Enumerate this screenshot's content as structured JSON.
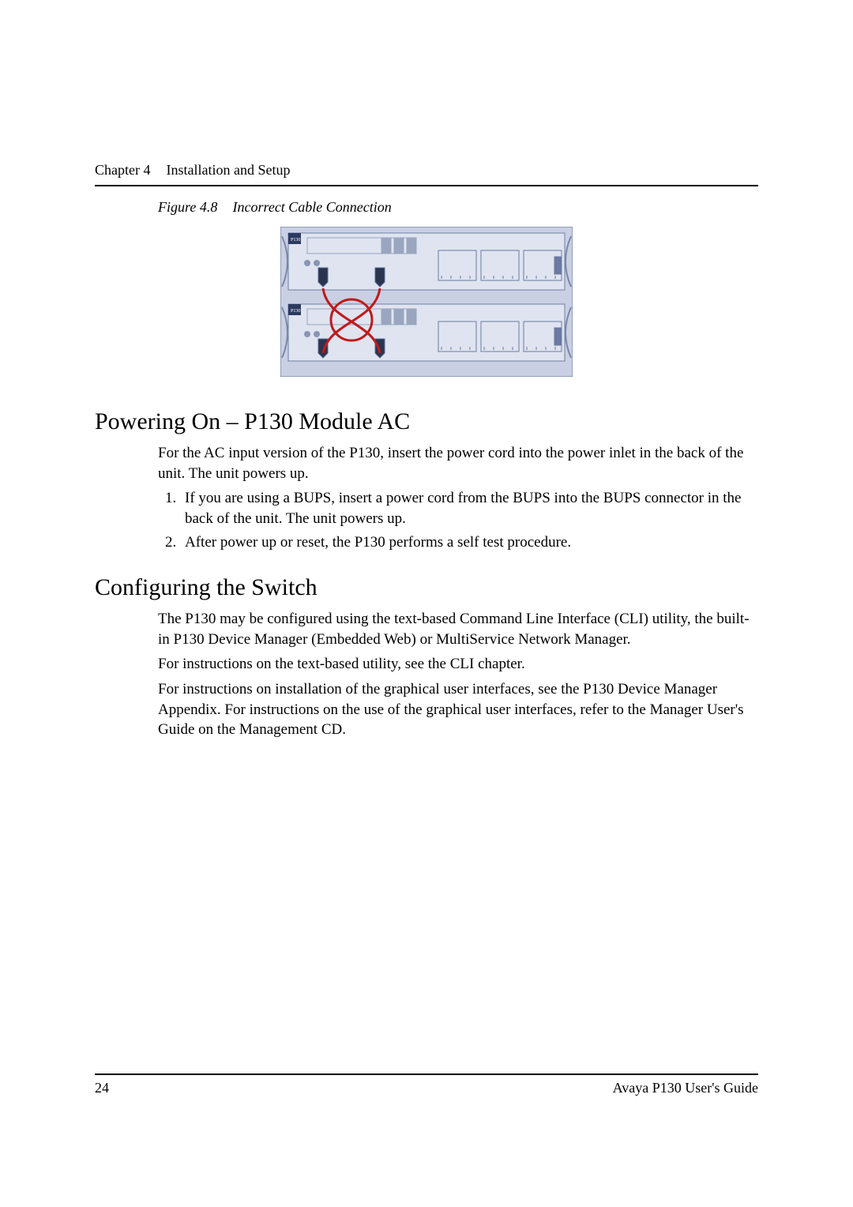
{
  "chapter": {
    "label": "Chapter 4",
    "title": "Installation and Setup"
  },
  "figure": {
    "number": "Figure 4.8",
    "caption": "Incorrect Cable Connection"
  },
  "h1": "Powering On – P130 Module AC",
  "p1": "For the AC input version of the P130, insert the power cord into the power inlet in the back of the unit. The unit powers up.",
  "li1": "If you are using a BUPS, insert a power cord from the BUPS into the BUPS connector in the back of the unit. The unit powers up.",
  "li2": "After power up or reset, the P130 performs a self test procedure.",
  "h2": "Configuring the Switch",
  "p2": "The P130 may be configured using the text-based Command Line Interface (CLI) utility, the built-in P130 Device Manager (Embedded Web) or MultiService Network Manager.",
  "p3": "For instructions on the text-based utility, see the CLI chapter.",
  "p4": "For instructions on installation of the graphical user interfaces, see the P130 Device Manager Appendix. For instructions on the use of the graphical user interfaces, refer to the Manager User's Guide on the Management CD.",
  "footer": {
    "page": "24",
    "guide": "Avaya P130 User's Guide"
  },
  "device_label": "P130"
}
